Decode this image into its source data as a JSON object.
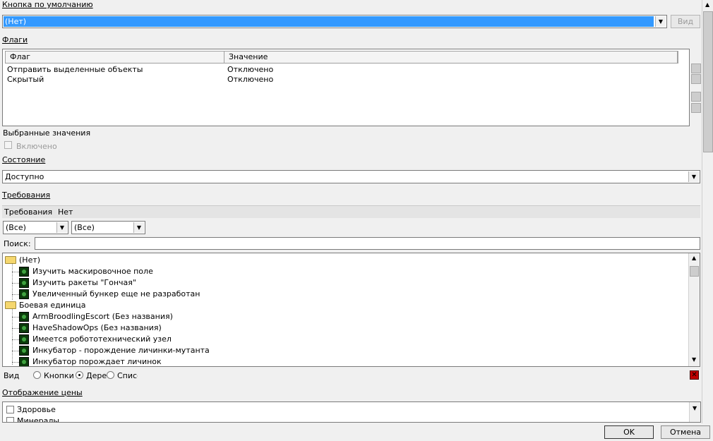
{
  "default_button": {
    "title": "Кнопка по умолчанию",
    "selected": "(Нет)",
    "view_button": "Вид"
  },
  "flags": {
    "title": "Флаги",
    "columns": [
      "Флаг",
      "Значение"
    ],
    "rows": [
      {
        "flag": "Отправить выделенные объекты",
        "value": "Отключено"
      },
      {
        "flag": "Скрытый",
        "value": "Отключено"
      }
    ],
    "chosen_values_label": "Выбранные значения",
    "enabled_checkbox": "Включено"
  },
  "state": {
    "title": "Состояние",
    "selected": "Доступно"
  },
  "requirements": {
    "title": "Требования",
    "label": "Требования",
    "value": "Нет",
    "filter1": "(Все)",
    "filter2": "(Все)",
    "search_label": "Поиск:",
    "search_value": "",
    "tree": [
      {
        "type": "folder",
        "label": "(Нет)"
      },
      {
        "type": "unit",
        "label": "Изучить маскировочное поле"
      },
      {
        "type": "unit",
        "label": "Изучить ракеты \"Гончая\""
      },
      {
        "type": "unit",
        "label": "Увеличенный бункер еще не разработан"
      },
      {
        "type": "folder",
        "label": "Боевая единица"
      },
      {
        "type": "unit",
        "label": "ArmBroodlingEscort (Без названия)"
      },
      {
        "type": "unit",
        "label": "HaveShadowOps (Без названия)"
      },
      {
        "type": "unit",
        "label": "Имеется робототехнический узел"
      },
      {
        "type": "unit",
        "label": "Инкубатор - порождение личинки-мутанта"
      },
      {
        "type": "unit",
        "label": "Инкубатор порождает личинок"
      }
    ],
    "view_label": "Вид",
    "view_options": [
      "Кнопки",
      "Дере",
      "Списс"
    ]
  },
  "price_display": {
    "title": "Отображение цены",
    "items": [
      "Здоровье",
      "Минералы"
    ]
  },
  "footer": {
    "ok": "OK",
    "cancel": "Отмена"
  }
}
